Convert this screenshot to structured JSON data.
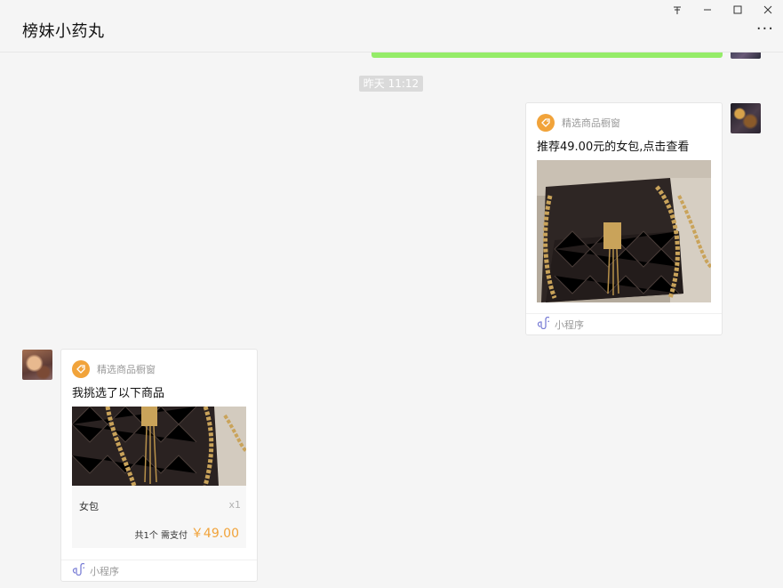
{
  "window": {
    "controls": [
      "pin",
      "minimize",
      "maximize",
      "close"
    ],
    "pin_glyph": "ᅎ",
    "minimize_glyph": "─",
    "maximize_glyph": "☐",
    "close_glyph": "✕"
  },
  "header": {
    "title": "榜妹小药丸",
    "more_glyph": "···"
  },
  "chat": {
    "timestamp": "昨天 11:12",
    "messages": [
      {
        "sender": "me",
        "shop_name": "精选商品橱窗",
        "title": "推荐49.00元的女包,点击查看",
        "footer_label": "小程序"
      },
      {
        "sender": "other",
        "shop_name": "精选商品橱窗",
        "title": "我挑选了以下商品",
        "item_name": "女包",
        "item_qty": "x1",
        "total_label": "共1个 需支付",
        "total_price": "￥49.00",
        "footer_label": "小程序"
      }
    ]
  },
  "colors": {
    "accent_orange": "#f1a33a",
    "bubble_green": "#95ec69",
    "background": "#f5f5f5"
  },
  "icons": [
    "pin-icon",
    "minimize-icon",
    "maximize-icon",
    "close-icon",
    "more-icon",
    "shop-tag-icon",
    "mini-program-icon"
  ]
}
